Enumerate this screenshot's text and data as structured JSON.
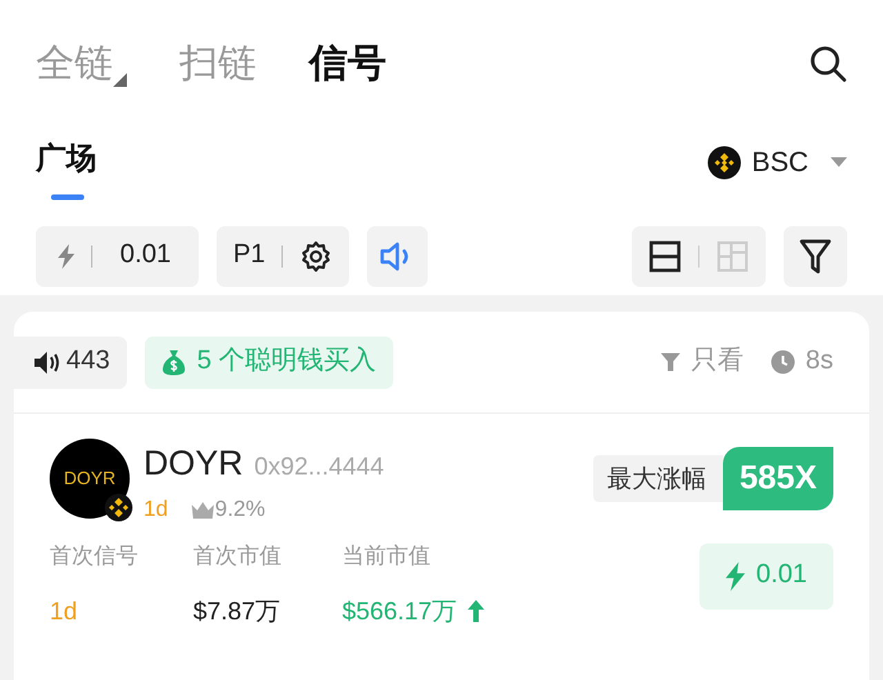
{
  "tabs": [
    {
      "label": "全链",
      "selected": false,
      "dropdown": true
    },
    {
      "label": "扫链",
      "selected": false,
      "dropdown": false
    },
    {
      "label": "信号",
      "selected": true,
      "dropdown": false
    }
  ],
  "subtabs": [
    {
      "label": "广场",
      "selected": true
    }
  ],
  "chain": {
    "label": "BSC"
  },
  "toolbar": {
    "amount": "0.01",
    "preset": "P1",
    "sound_on": true,
    "layouts": [
      {
        "kind": "rows",
        "selected": true
      },
      {
        "kind": "grid",
        "selected": false
      }
    ]
  },
  "signal": {
    "count": "443",
    "smart_money": "5 个聪明钱买入",
    "filter_label": "只看",
    "age": "8s"
  },
  "token": {
    "logo_text": "DOYR",
    "symbol": "DOYR",
    "address": "0x92...4444",
    "age": "1d",
    "top_share": "9.2%",
    "max_gain_label": "最大涨幅",
    "max_gain": "585X",
    "stats": [
      {
        "label": "首次信号",
        "value": "1d",
        "color": "#f0a020",
        "rising": false
      },
      {
        "label": "首次市值",
        "value": "$7.87万",
        "color": "#222222",
        "rising": false
      },
      {
        "label": "当前市值",
        "value": "$566.17万",
        "color": "#22b573",
        "rising": true
      }
    ],
    "buy_amount": "0.01"
  }
}
